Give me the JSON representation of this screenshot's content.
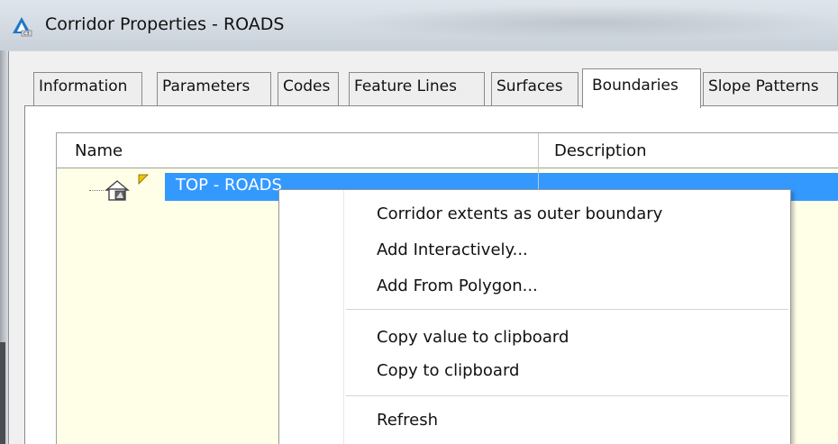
{
  "window": {
    "title": "Corridor Properties - ROADS"
  },
  "tabs": [
    {
      "label": "Information",
      "active": false
    },
    {
      "label": "Parameters",
      "active": false
    },
    {
      "label": "Codes",
      "active": false
    },
    {
      "label": "Feature Lines",
      "active": false
    },
    {
      "label": "Surfaces",
      "active": false
    },
    {
      "label": "Boundaries",
      "active": true
    },
    {
      "label": "Slope Patterns",
      "active": false
    }
  ],
  "grid": {
    "columns": {
      "name": "Name",
      "description": "Description"
    },
    "rows": [
      {
        "name": "TOP - ROADS",
        "description": "",
        "selected": true
      }
    ]
  },
  "context_menu": {
    "groups": [
      [
        "Corridor extents as outer boundary",
        "Add Interactively...",
        "Add From Polygon..."
      ],
      [
        "Copy value to clipboard",
        "Copy to clipboard"
      ],
      [
        "Refresh"
      ]
    ]
  },
  "colors": {
    "selection": "#3399ff",
    "grid_background": "#ffffe8",
    "app_icon": "#1f77c8",
    "flag": "#f2c400"
  },
  "icons": {
    "app": "civil3d-app-icon",
    "boundary": "boundary-house-icon",
    "flag": "yellow-flag-icon"
  }
}
